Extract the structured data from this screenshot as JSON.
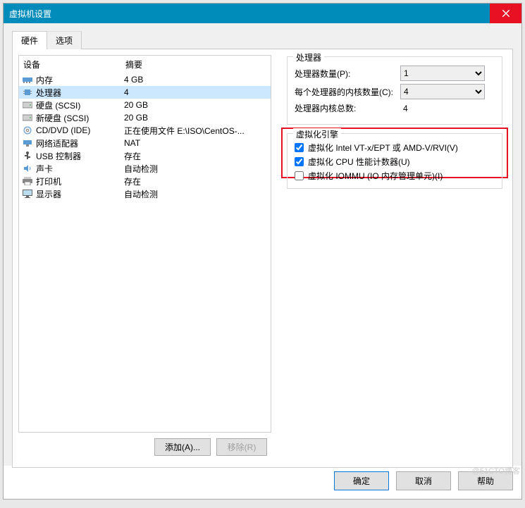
{
  "window": {
    "title": "虚拟机设置"
  },
  "tabs": {
    "hardware": "硬件",
    "options": "选项"
  },
  "listHeaders": {
    "device": "设备",
    "summary": "摘要"
  },
  "devices": [
    {
      "name": "内存",
      "summary": "4 GB",
      "icon": "memory-icon"
    },
    {
      "name": "处理器",
      "summary": "4",
      "icon": "cpu-icon",
      "selected": true
    },
    {
      "name": "硬盘 (SCSI)",
      "summary": "20 GB",
      "icon": "hdd-icon"
    },
    {
      "name": "新硬盘 (SCSI)",
      "summary": "20 GB",
      "icon": "hdd-icon"
    },
    {
      "name": "CD/DVD (IDE)",
      "summary": "正在使用文件 E:\\ISO\\CentOS-...",
      "icon": "cd-icon"
    },
    {
      "name": "网络适配器",
      "summary": "NAT",
      "icon": "network-icon"
    },
    {
      "name": "USB 控制器",
      "summary": "存在",
      "icon": "usb-icon"
    },
    {
      "name": "声卡",
      "summary": "自动检测",
      "icon": "sound-icon"
    },
    {
      "name": "打印机",
      "summary": "存在",
      "icon": "printer-icon"
    },
    {
      "name": "显示器",
      "summary": "自动检测",
      "icon": "display-icon"
    }
  ],
  "buttons": {
    "add": "添加(A)...",
    "remove": "移除(R)",
    "ok": "确定",
    "cancel": "取消",
    "help": "帮助"
  },
  "processor": {
    "groupTitle": "处理器",
    "countLabel": "处理器数量(P):",
    "countValue": "1",
    "coresLabel": "每个处理器的内核数量(C):",
    "coresValue": "4",
    "totalLabel": "处理器内核总数:",
    "totalValue": "4"
  },
  "virtEngine": {
    "groupTitle": "虚拟化引擎",
    "vt": {
      "label": "虚拟化 Intel VT-x/EPT 或 AMD-V/RVI(V)",
      "checked": true
    },
    "perf": {
      "label": "虚拟化 CPU 性能计数器(U)",
      "checked": true
    },
    "iommu": {
      "label": "虚拟化 IOMMU (IO 内存管理单元)(I)",
      "checked": false
    }
  },
  "watermark": "@51CTO博客"
}
